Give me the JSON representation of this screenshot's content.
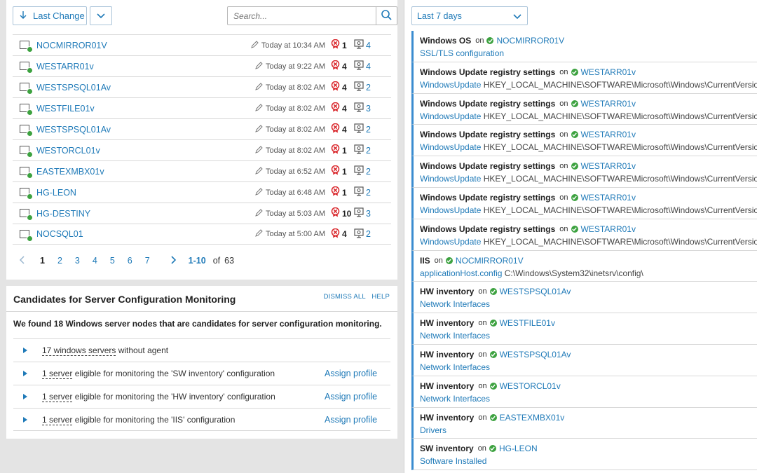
{
  "toolbar": {
    "sort_label": "Last Change",
    "search_placeholder": "Search..."
  },
  "nodes": [
    {
      "name": "NOCMIRROR01V",
      "time": "Today at 10:34 AM",
      "alerts": "1",
      "configs": "4"
    },
    {
      "name": "WESTARR01v",
      "time": "Today at 9:22 AM",
      "alerts": "4",
      "configs": "4"
    },
    {
      "name": "WESTSPSQL01Av",
      "time": "Today at 8:02 AM",
      "alerts": "4",
      "configs": "2"
    },
    {
      "name": "WESTFILE01v",
      "time": "Today at 8:02 AM",
      "alerts": "4",
      "configs": "3"
    },
    {
      "name": "WESTSPSQL01Av",
      "time": "Today at 8:02 AM",
      "alerts": "4",
      "configs": "2"
    },
    {
      "name": "WESTORCL01v",
      "time": "Today at 8:02 AM",
      "alerts": "1",
      "configs": "2"
    },
    {
      "name": "EASTEXMBX01v",
      "time": "Today at 6:52 AM",
      "alerts": "1",
      "configs": "2"
    },
    {
      "name": "HG-LEON",
      "time": "Today at 6:48 AM",
      "alerts": "1",
      "configs": "2"
    },
    {
      "name": "HG-DESTINY",
      "time": "Today at 5:03 AM",
      "alerts": "10",
      "configs": "3"
    },
    {
      "name": "NOCSQL01",
      "time": "Today at 5:00 AM",
      "alerts": "4",
      "configs": "2"
    }
  ],
  "pager": {
    "pages": [
      "1",
      "2",
      "3",
      "4",
      "5",
      "6",
      "7"
    ],
    "range": "1-10",
    "of": "of",
    "total": "63"
  },
  "candidates": {
    "title": "Candidates for Server Configuration Monitoring",
    "dismiss": "DISMISS ALL",
    "help": "HELP",
    "summary": "We found 18 Windows server nodes that are candidates for server configuration monitoring.",
    "rows": [
      {
        "link": "17 windows servers",
        "rest": " without agent",
        "action": ""
      },
      {
        "link": "1 server",
        "rest": " eligible for monitoring the 'SW inventory' configuration",
        "action": "Assign profile"
      },
      {
        "link": "1 server",
        "rest": " eligible for monitoring the 'HW inventory' configuration",
        "action": "Assign profile"
      },
      {
        "link": "1 server",
        "rest": " eligible for monitoring the 'IIS' configuration",
        "action": "Assign profile"
      }
    ]
  },
  "period": {
    "label": "Last 7 days"
  },
  "changes": [
    {
      "title": "Windows OS",
      "on": "on",
      "node": "NOCMIRROR01V",
      "detail": "SSL/TLS configuration",
      "path": ""
    },
    {
      "title": "Windows Update registry settings",
      "on": "on",
      "node": "WESTARR01v",
      "detail": "WindowsUpdate",
      "path": " HKEY_LOCAL_MACHINE\\SOFTWARE\\Microsoft\\Windows\\CurrentVersion\\"
    },
    {
      "title": "Windows Update registry settings",
      "on": "on",
      "node": "WESTARR01v",
      "detail": "WindowsUpdate",
      "path": " HKEY_LOCAL_MACHINE\\SOFTWARE\\Microsoft\\Windows\\CurrentVersion\\"
    },
    {
      "title": "Windows Update registry settings",
      "on": "on",
      "node": "WESTARR01v",
      "detail": "WindowsUpdate",
      "path": " HKEY_LOCAL_MACHINE\\SOFTWARE\\Microsoft\\Windows\\CurrentVersion\\"
    },
    {
      "title": "Windows Update registry settings",
      "on": "on",
      "node": "WESTARR01v",
      "detail": "WindowsUpdate",
      "path": " HKEY_LOCAL_MACHINE\\SOFTWARE\\Microsoft\\Windows\\CurrentVersion\\"
    },
    {
      "title": "Windows Update registry settings",
      "on": "on",
      "node": "WESTARR01v",
      "detail": "WindowsUpdate",
      "path": " HKEY_LOCAL_MACHINE\\SOFTWARE\\Microsoft\\Windows\\CurrentVersion\\"
    },
    {
      "title": "Windows Update registry settings",
      "on": "on",
      "node": "WESTARR01v",
      "detail": "WindowsUpdate",
      "path": " HKEY_LOCAL_MACHINE\\SOFTWARE\\Microsoft\\Windows\\CurrentVersion\\"
    },
    {
      "title": "IIS",
      "on": "on",
      "node": "NOCMIRROR01V",
      "detail": "applicationHost.config",
      "path": " C:\\Windows\\System32\\inetsrv\\config\\"
    },
    {
      "title": "HW inventory",
      "on": "on",
      "node": "WESTSPSQL01Av",
      "detail": "Network Interfaces",
      "path": ""
    },
    {
      "title": "HW inventory",
      "on": "on",
      "node": "WESTFILE01v",
      "detail": "Network Interfaces",
      "path": ""
    },
    {
      "title": "HW inventory",
      "on": "on",
      "node": "WESTSPSQL01Av",
      "detail": "Network Interfaces",
      "path": ""
    },
    {
      "title": "HW inventory",
      "on": "on",
      "node": "WESTORCL01v",
      "detail": "Network Interfaces",
      "path": ""
    },
    {
      "title": "HW inventory",
      "on": "on",
      "node": "EASTEXMBX01v",
      "detail": "Drivers",
      "path": ""
    },
    {
      "title": "SW inventory",
      "on": "on",
      "node": "HG-LEON",
      "detail": "Software Installed",
      "path": ""
    }
  ],
  "colors": {
    "accent": "#1f7ab8",
    "ok": "#3da240",
    "alert": "#d9262b",
    "change_bar": "#3a8cd0"
  }
}
